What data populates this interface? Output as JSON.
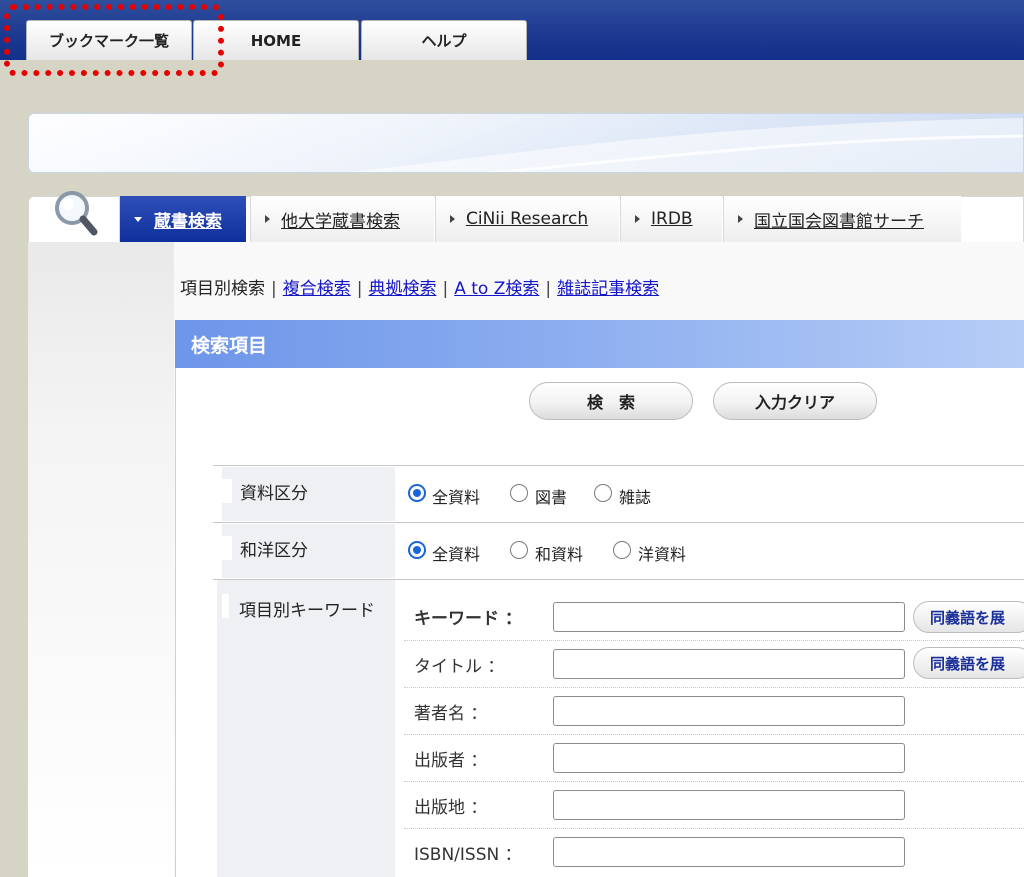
{
  "top_tabs": [
    {
      "label": "ブックマーク一覧"
    },
    {
      "label": "HOME"
    },
    {
      "label": "ヘルプ"
    }
  ],
  "nav_tabs": [
    {
      "label": "蔵書検索",
      "active": true
    },
    {
      "label": "他大学蔵書検索"
    },
    {
      "label": "CiNii Research"
    },
    {
      "label": "IRDB"
    },
    {
      "label": "国立国会図書館サーチ"
    }
  ],
  "sub_nav": {
    "current": "項目別検索",
    "links": [
      "複合検索",
      "典拠検索",
      "A to Z検索",
      "雑誌記事検索"
    ],
    "separator": "|"
  },
  "section_title": "検索項目",
  "buttons": {
    "search": "検　索",
    "clear": "入力クリア"
  },
  "material_type": {
    "label": "資料区分",
    "options": [
      "全資料",
      "図書",
      "雑誌"
    ],
    "selected": "全資料"
  },
  "language_type": {
    "label": "和洋区分",
    "options": [
      "全資料",
      "和資料",
      "洋資料"
    ],
    "selected": "全資料"
  },
  "keywords": {
    "label": "項目別キーワード",
    "fields": [
      {
        "label": "キーワード ：",
        "value": "",
        "synonym": "同義語を展"
      },
      {
        "label": "タイトル ：",
        "value": "",
        "synonym": "同義語を展"
      },
      {
        "label": "著者名 ：",
        "value": ""
      },
      {
        "label": "出版者 ：",
        "value": ""
      },
      {
        "label": "出版地 ：",
        "value": ""
      },
      {
        "label": "ISBN/ISSN ：",
        "value": ""
      }
    ]
  },
  "colors": {
    "accent": "#1c3890",
    "highlight": "#e60000",
    "section": "#6d95e9",
    "radio": "#1a66d6"
  }
}
